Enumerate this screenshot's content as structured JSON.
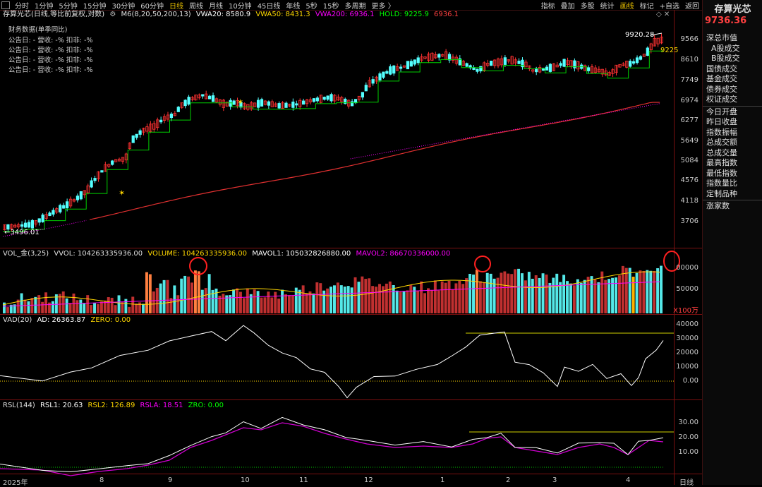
{
  "toolbar": {
    "periods": [
      "分时",
      "1分钟",
      "5分钟",
      "15分钟",
      "30分钟",
      "60分钟",
      "日线",
      "周线",
      "月线",
      "10分钟",
      "45日线",
      "年线",
      "5秒",
      "15秒",
      "多周期",
      "更多 〉"
    ],
    "active_period": "日线",
    "tools": [
      "指标",
      "叠加",
      "多股",
      "统计",
      "画线",
      "标记",
      "+自选",
      "返回"
    ],
    "active_tool": "画线"
  },
  "price_panel": {
    "title": "存算光芯(日线,等比前复权,对数)",
    "ma_name": "M6(8,20,50,200,13)",
    "vwa20": "VWA20: 8580.9",
    "vwa50": "VWA50: 8431.3",
    "vwa200": "VWA200: 6936.1",
    "hold": "HOLD: 9225.9",
    "hold2": "6936.1",
    "fin_title": "财务数据(单季同比)",
    "fin_rows": [
      "公告日: -    营收: -%    扣非: -%",
      "公告日: -    营收: -%    扣非: -%",
      "公告日: -    营收: -%    扣非: -%",
      "公告日: -    营收: -%    扣非: -%"
    ],
    "y_labels": [
      "9566",
      "8610",
      "7749",
      "6974",
      "6277",
      "5649",
      "5084",
      "4576",
      "4118",
      "3706"
    ],
    "high_label": "9920.28",
    "low_label": "3496.01",
    "hold_label": "9225"
  },
  "volume_panel": {
    "name": "VOL_金(3,25)",
    "vvol": "VVOL: 104263335936.00",
    "volume": "VOLUME: 104263335936.00",
    "mavol1": "MAVOL1: 105032826880.00",
    "mavol2": "MAVOL2: 86670336000.00",
    "y_labels": [
      "00000",
      "50000"
    ],
    "unit": "X100万"
  },
  "vad_panel": {
    "name": "VAD(20)",
    "ad": "AD: 26363.87",
    "zero": "ZERO: 0.00",
    "y_labels": [
      "40000",
      "30000",
      "20000",
      "10000",
      "0.00"
    ]
  },
  "rsl_panel": {
    "name": "RSL(144)",
    "rsl1": "RSL1: 20.63",
    "rsl2": "RSL2: 126.89",
    "rsla": "RSLA: 18.51",
    "zro": "ZRO: 0.00",
    "y_labels": [
      "30.00",
      "20.00",
      "10.00"
    ]
  },
  "x_axis": {
    "labels": [
      "2025年",
      "8",
      "9",
      "10",
      "11",
      "12",
      "1",
      "2",
      "3",
      "4"
    ],
    "period": "日线"
  },
  "sidebar": {
    "stock_name": "存算光芯",
    "price": "9736.36",
    "items": [
      "深总市值",
      "A股成交",
      "B股成交",
      "国债成交",
      "基金成交",
      "债券成交",
      "权证成交",
      "今日开盘",
      "昨日收盘",
      "指数振幅",
      "总成交额",
      "总成交量",
      "最高指数",
      "最低指数",
      "指数量比",
      "定制品种",
      "涨家数"
    ]
  },
  "colors": {
    "up": "#ff3232",
    "down": "#54ffff",
    "vwa20": "#ffffff",
    "vwa50": "#ffd700",
    "vwa200": "#ff00ff",
    "hold": "#00ff00",
    "hold2": "#ff3232"
  }
}
